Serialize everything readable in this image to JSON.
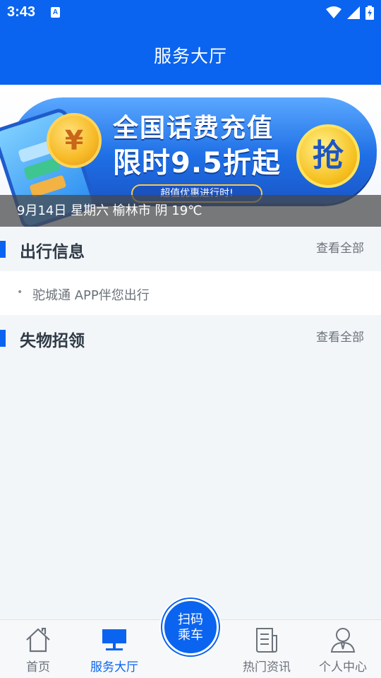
{
  "status_bar": {
    "time": "3:43",
    "notification_icon_letter": "A",
    "icons": [
      "wifi-icon",
      "signal-icon",
      "battery-icon"
    ]
  },
  "header": {
    "title": "服务大厅"
  },
  "banner": {
    "line1": "全国话费充值",
    "line2": "限时9.5折起",
    "tag": "超值优惠进行时!",
    "coin_symbol": "¥",
    "action_char": "抢",
    "caption": "9月14日 星期六 榆林市 阴 19℃"
  },
  "sections": {
    "travel": {
      "title": "出行信息",
      "more": "查看全部",
      "items": [
        "驼城通 APP伴您出行"
      ]
    },
    "lost_found": {
      "title": "失物招领",
      "more": "查看全部"
    }
  },
  "bottom_nav": {
    "items": [
      {
        "label": "首页",
        "icon": "home-icon"
      },
      {
        "label": "服务大厅",
        "icon": "service-hall-icon"
      },
      {
        "label": "热门资讯",
        "icon": "news-icon"
      },
      {
        "label": "个人中心",
        "icon": "profile-icon"
      }
    ],
    "scan_button": {
      "line1": "扫码",
      "line2": "乘车"
    }
  },
  "colors": {
    "brand_blue": "#0a64f0",
    "background": "#f3f6f9",
    "inactive_text": "#6b727a"
  }
}
